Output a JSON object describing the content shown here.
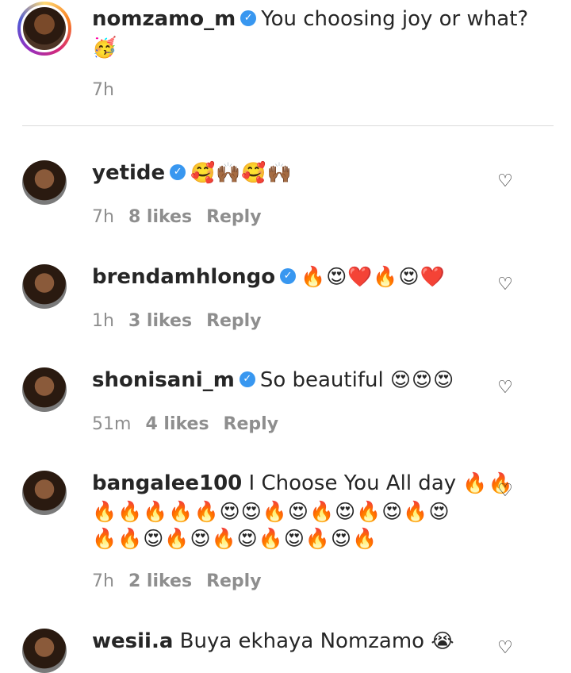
{
  "post": {
    "username": "nomzamo_m",
    "caption": "You choosing joy or what?",
    "caption_emoji": "🥳",
    "time": "7h"
  },
  "comments": [
    {
      "username": "yetide",
      "text": "",
      "emoji": "🥰🙌🏾🥰🙌🏾",
      "time": "7h",
      "likes": "8 likes",
      "reply": "Reply"
    },
    {
      "username": "brendamhlongo",
      "text": "",
      "emoji": "🔥😍❤️🔥😍❤️",
      "time": "1h",
      "likes": "3 likes",
      "reply": "Reply"
    },
    {
      "username": "shonisani_m",
      "text": "So beautiful",
      "emoji": "😍😍😍",
      "time": "51m",
      "likes": "4 likes",
      "reply": "Reply"
    },
    {
      "username": "bangalee100",
      "text": "I Choose You All day",
      "emoji": "🔥🔥",
      "emoji_line2": "🔥🔥🔥🔥🔥😍😍🔥😍🔥😍🔥😍🔥😍",
      "emoji_line3": "🔥🔥😍🔥😍🔥😍🔥😍🔥😍🔥",
      "time": "7h",
      "likes": "2 likes",
      "reply": "Reply"
    },
    {
      "username": "wesii.a",
      "text": "Buya ekhaya Nomzamo",
      "emoji": "😭"
    }
  ],
  "icons": {
    "verified": "verified-badge-icon",
    "heart": "heart-outline-icon"
  }
}
